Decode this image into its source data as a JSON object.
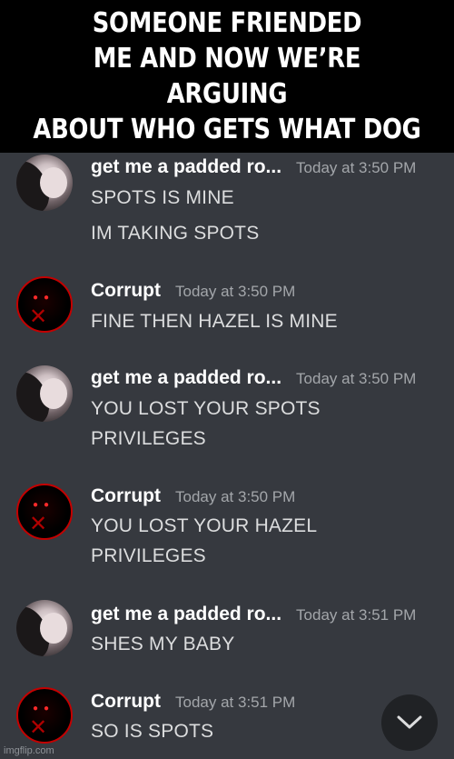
{
  "caption": "SOMEONE FRIENDED\nME AND NOW WE’RE ARGUING\nABOUT WHO GETS WHAT DOG",
  "messages": [
    {
      "username": "get me a padded ro...",
      "timestamp": "Today at 3:50 PM",
      "avatar": "profile-photo",
      "lines": [
        "SPOTS IS MINE",
        "IM TAKING SPOTS"
      ]
    },
    {
      "username": "Corrupt",
      "timestamp": "Today at 3:50 PM",
      "avatar": "corrupt-avatar",
      "lines": [
        "FINE THEN HAZEL IS MINE"
      ]
    },
    {
      "username": "get me a padded ro...",
      "timestamp": "Today at 3:50 PM",
      "avatar": "profile-photo",
      "lines": [
        "YOU LOST YOUR SPOTS",
        "PRIVILEGES"
      ]
    },
    {
      "username": "Corrupt",
      "timestamp": "Today at 3:50 PM",
      "avatar": "corrupt-avatar",
      "lines": [
        "YOU LOST YOUR HAZEL",
        "PRIVILEGES"
      ]
    },
    {
      "username": "get me a padded ro...",
      "timestamp": "Today at 3:51 PM",
      "avatar": "profile-photo",
      "lines": [
        "SHES MY BABY"
      ]
    },
    {
      "username": "Corrupt",
      "timestamp": "Today at 3:51 PM",
      "avatar": "corrupt-avatar",
      "lines": [
        "SO IS SPOTS"
      ]
    }
  ],
  "jump_button_icon": "chevron-down-icon",
  "watermark": "imgflip.com",
  "colors": {
    "background": "#36393f",
    "caption_background": "#000000",
    "username": "#ffffff",
    "message_text": "#dcddde",
    "timestamp": "#a3a6aa"
  }
}
